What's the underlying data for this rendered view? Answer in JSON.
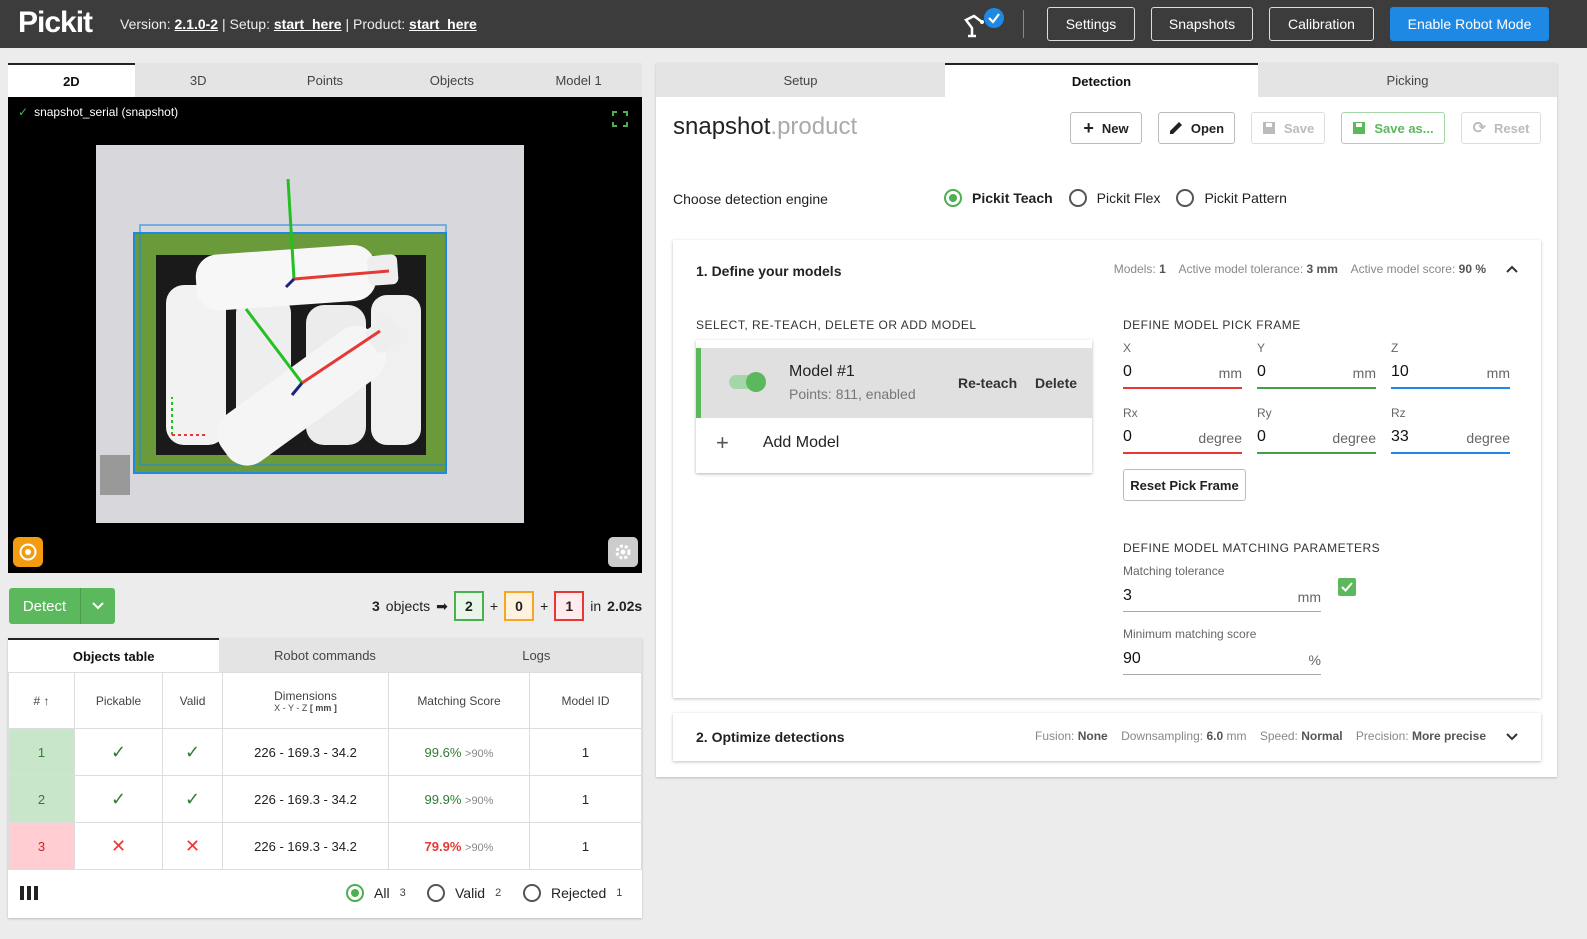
{
  "header": {
    "logo_text": "Pickit",
    "version_label": "Version:",
    "version": "2.1.0-2",
    "setup_label": "| Setup:",
    "setup": "start_here",
    "product_label": "| Product:",
    "product": "start_here",
    "buttons": {
      "settings": "Settings",
      "snapshots": "Snapshots",
      "calibration": "Calibration",
      "robot_mode": "Enable Robot Mode"
    }
  },
  "viewer": {
    "tabs": [
      "2D",
      "3D",
      "Points",
      "Objects",
      "Model 1"
    ],
    "snapshot_label": "snapshot_serial (snapshot)"
  },
  "detect": {
    "button": "Detect",
    "count": "3",
    "objects_label": "objects",
    "arrow": "➡",
    "valid": "2",
    "warn": "0",
    "rejected": "1",
    "plus": "+",
    "time_prefix": "in",
    "time": "2.02s"
  },
  "objects_table": {
    "tabs": [
      "Objects table",
      "Robot commands",
      "Logs"
    ],
    "headers": {
      "num": "#",
      "pickable": "Pickable",
      "valid": "Valid",
      "dimensions": "Dimensions",
      "dim_sub": "X - Y - Z",
      "dim_unit": "[ mm ]",
      "score": "Matching Score",
      "model_id": "Model ID"
    },
    "rows": [
      {
        "num": "1",
        "dims": "226 - 169.3 - 34.2",
        "score": "99.6%",
        "thresh": ">90%",
        "model": "1"
      },
      {
        "num": "2",
        "dims": "226 - 169.3 - 34.2",
        "score": "99.9%",
        "thresh": ">90%",
        "model": "1"
      },
      {
        "num": "3",
        "dims": "226 - 169.3 - 34.2",
        "score": "79.9%",
        "thresh": ">90%",
        "model": "1"
      }
    ],
    "filters": [
      {
        "label": "All",
        "count": "3"
      },
      {
        "label": "Valid",
        "count": "2"
      },
      {
        "label": "Rejected",
        "count": "1"
      }
    ]
  },
  "right": {
    "tabs": [
      "Setup",
      "Detection",
      "Picking"
    ],
    "product_name": "snapshot",
    "product_ext": ".product",
    "actions": {
      "new": "New",
      "open": "Open",
      "save": "Save",
      "save_as": "Save as...",
      "reset": "Reset"
    },
    "engine_label": "Choose detection engine",
    "engines": [
      "Pickit Teach",
      "Pickit Flex",
      "Pickit Pattern"
    ],
    "section1": {
      "title": "1. Define your models",
      "models_label": "Models:",
      "models": "1",
      "tol_label": "Active model tolerance:",
      "tol": "3 mm",
      "score_label": "Active model score:",
      "score": "90 %",
      "select_heading": "SELECT, RE-TEACH, DELETE OR ADD MODEL",
      "model_name": "Model #1",
      "model_sub": "Points: 811, enabled",
      "reteach": "Re-teach",
      "delete": "Delete",
      "add_model": "Add Model",
      "pickframe_heading": "DEFINE MODEL PICK FRAME",
      "pick": {
        "x": {
          "label": "X",
          "value": "0",
          "unit": "mm"
        },
        "y": {
          "label": "Y",
          "value": "0",
          "unit": "mm"
        },
        "z": {
          "label": "Z",
          "value": "10",
          "unit": "mm"
        },
        "rx": {
          "label": "Rx",
          "value": "0",
          "unit": "degree"
        },
        "ry": {
          "label": "Ry",
          "value": "0",
          "unit": "degree"
        },
        "rz": {
          "label": "Rz",
          "value": "33",
          "unit": "degree"
        }
      },
      "reset_pick": "Reset Pick Frame",
      "matching_heading": "DEFINE MODEL MATCHING PARAMETERS",
      "tolerance": {
        "label": "Matching tolerance",
        "value": "3",
        "unit": "mm"
      },
      "min_score": {
        "label": "Minimum matching score",
        "value": "90",
        "unit": "%"
      }
    },
    "section2": {
      "title": "2. Optimize detections",
      "fusion_label": "Fusion:",
      "fusion": "None",
      "down_label": "Downsampling:",
      "down": "6.0",
      "down_unit": "mm",
      "speed_label": "Speed:",
      "speed": "Normal",
      "prec_label": "Precision:",
      "prec": "More precise"
    }
  }
}
